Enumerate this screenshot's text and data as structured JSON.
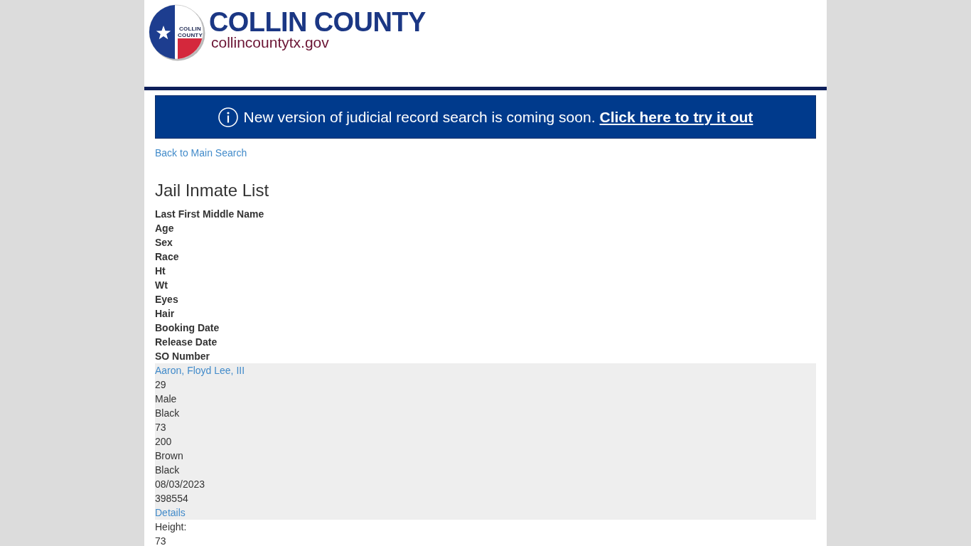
{
  "header": {
    "seal_text": [
      "COLLIN",
      "COUNTY"
    ],
    "title": "COLLIN COUNTY",
    "website": "collincountytx.gov"
  },
  "banner": {
    "message": "New version of judicial record search is coming soon.",
    "link": "Click here to try it out"
  },
  "back_link": "Back to Main Search",
  "heading": "Jail Inmate List",
  "columns": [
    "Last First Middle Name",
    "Age",
    "Sex",
    "Race",
    "Ht",
    "Wt",
    "Eyes",
    "Hair",
    "Booking Date",
    "Release Date",
    "SO Number"
  ],
  "records": [
    {
      "cells": [
        {
          "kind": "name",
          "text": "Aaron, Floyd Lee, III"
        },
        {
          "kind": "value",
          "text": "29"
        },
        {
          "kind": "value",
          "text": "Male"
        },
        {
          "kind": "value",
          "text": "Black"
        },
        {
          "kind": "value",
          "text": "73"
        },
        {
          "kind": "value",
          "text": "200"
        },
        {
          "kind": "value",
          "text": "Brown"
        },
        {
          "kind": "value",
          "text": "Black"
        },
        {
          "kind": "value",
          "text": "08/03/2023"
        },
        {
          "kind": "value",
          "text": "398554"
        },
        {
          "kind": "details",
          "text": "Details"
        }
      ],
      "detail_lines": [
        "Height:",
        "73"
      ]
    }
  ]
}
